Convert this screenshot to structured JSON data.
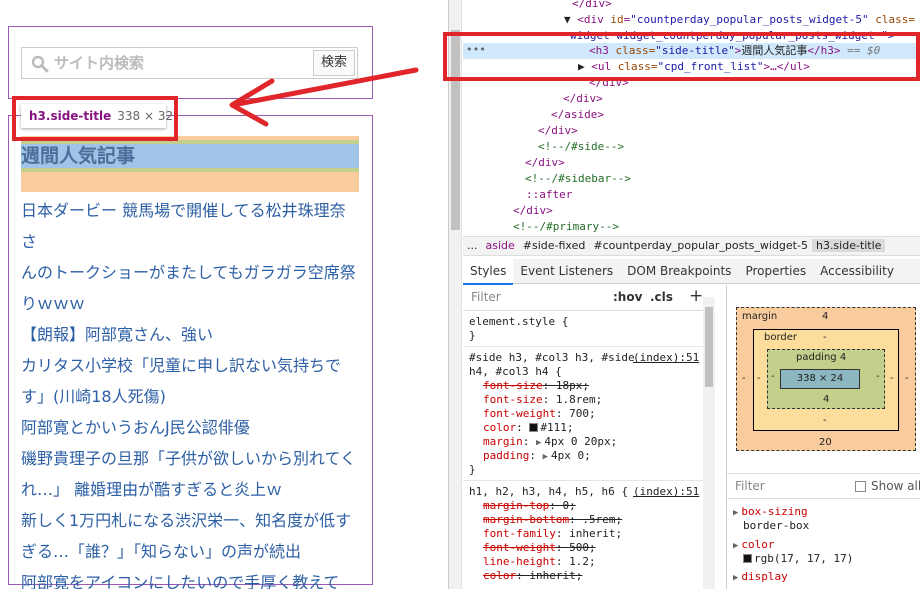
{
  "preview": {
    "search": {
      "placeholder": "サイト内検索",
      "button_label": "検索"
    },
    "tooltip": {
      "selector": "h3.side-title",
      "size": "338 × 32"
    },
    "side_title": "週間人気記事",
    "posts": [
      "日本ダービー 競馬場で開催してる松井珠理奈さ",
      "んのトークショーがまたしてもガラガラ空席祭",
      "りｗｗｗ",
      "【朗報】阿部寛さん、強い",
      "カリタス小学校「児童に申し訳ない気持ちで",
      "す」(川崎18人死傷)",
      "阿部寛とかいうおんJ民公認俳優",
      "磯野貴理子の旦那「子供が欲しいから別れてく",
      "れ…」 離婚理由が酷すぎると炎上ｗ",
      "新しく1万円札になる渋沢栄一、知名度が低す",
      "ぎる…「誰？」「知らない」の声が続出",
      "阿部寛をアイコンにしたいので手厚く教えて"
    ],
    "colors": {
      "callout": "#e0262a",
      "box_outline": "#9b59b6",
      "link": "#2d5fa5"
    }
  },
  "devtools": {
    "elements": {
      "close_div_1": "</div>",
      "open_div_tag": "div",
      "open_div_attr": "id",
      "open_div_val": "\"countperday_popular_posts_widget-5\"",
      "open_div_attr2": "class=",
      "class_cont": "widget widget_countperday_popular_posts_widget \">",
      "h3_open": "<h3",
      "h3_attr": "class=",
      "h3_val": "\"side-title\"",
      "h3_text": "週間人気記事",
      "h3_close": "</h3>",
      "h3_eq": "== $0",
      "ul_open": "<ul",
      "ul_attr": "class=",
      "ul_val": "\"cpd_front_list\"",
      "ul_rest": ">…</ul>",
      "close_div_2": "</div>",
      "close_div_3": "</div>",
      "close_aside": "</aside>",
      "close_div_4": "</div>",
      "comment_side": "<!--/#side-->",
      "close_div_5": "</div>",
      "comment_sidebar": "<!--/#sidebar-->",
      "after": "::after",
      "close_div_6": "</div>",
      "comment_primary": "<!--/#primary-->"
    },
    "breadcrumb": [
      "...",
      "aside",
      "#side-fixed",
      "#countperday_popular_posts_widget-5",
      "h3.side-title"
    ],
    "tabs": [
      "Styles",
      "Event Listeners",
      "DOM Breakpoints",
      "Properties",
      "Accessibility"
    ],
    "styles": {
      "filter_placeholder": "Filter",
      "hov": ":hov",
      "cls": ".cls",
      "plus": "+",
      "element_style": "element.style {",
      "close_brace": "}",
      "rule1_selector_a": "#side h3, #col3 h3, #side",
      "rule1_selector_b": "h4, #col3 h4 {",
      "rule1_source": "(index):51",
      "rule1_props": [
        {
          "name": "font-size",
          "value": "18px;",
          "struck": true
        },
        {
          "name": "font-size",
          "value": "1.8rem;",
          "struck": false
        },
        {
          "name": "font-weight",
          "value": "700;",
          "struck": false
        },
        {
          "name": "color",
          "value": "#111;",
          "struck": false,
          "swatch": "#111111"
        },
        {
          "name": "margin",
          "value": "4px 0 20px;",
          "struck": false,
          "caret": true
        },
        {
          "name": "padding",
          "value": "4px 0;",
          "struck": false,
          "caret": true
        }
      ],
      "rule2_selector": "h1, h2, h3, h4, h5, h6 {",
      "rule2_source": "(index):51",
      "rule2_props": [
        {
          "name": "margin-top",
          "value": "0;",
          "struck": true
        },
        {
          "name": "margin-bottom",
          "value": ".5rem;",
          "struck": true
        },
        {
          "name": "font-family",
          "value": "inherit;",
          "struck": false
        },
        {
          "name": "font-weight",
          "value": "500;",
          "struck": true
        },
        {
          "name": "line-height",
          "value": "1.2;",
          "struck": false
        },
        {
          "name": "color",
          "value": "inherit;",
          "struck": true
        }
      ]
    },
    "boxmodel": {
      "margin_label": "margin",
      "margin_top": "4",
      "margin_bottom": "20",
      "margin_left": "-",
      "margin_right": "-",
      "border_label": "border",
      "border_top": "-",
      "border_bottom": "-",
      "border_left": "-",
      "border_right": "-",
      "padding_label": "padding 4",
      "padding_bottom": "4",
      "padding_left": "-",
      "padding_right": "-",
      "content": "338 × 24"
    },
    "computed": {
      "filter_placeholder": "Filter",
      "show_all": "Show all",
      "props": [
        {
          "name": "box-sizing",
          "value": "border-box"
        },
        {
          "name": "color",
          "value": "rgb(17, 17, 17)"
        },
        {
          "name": "display",
          "value": ""
        }
      ]
    }
  }
}
